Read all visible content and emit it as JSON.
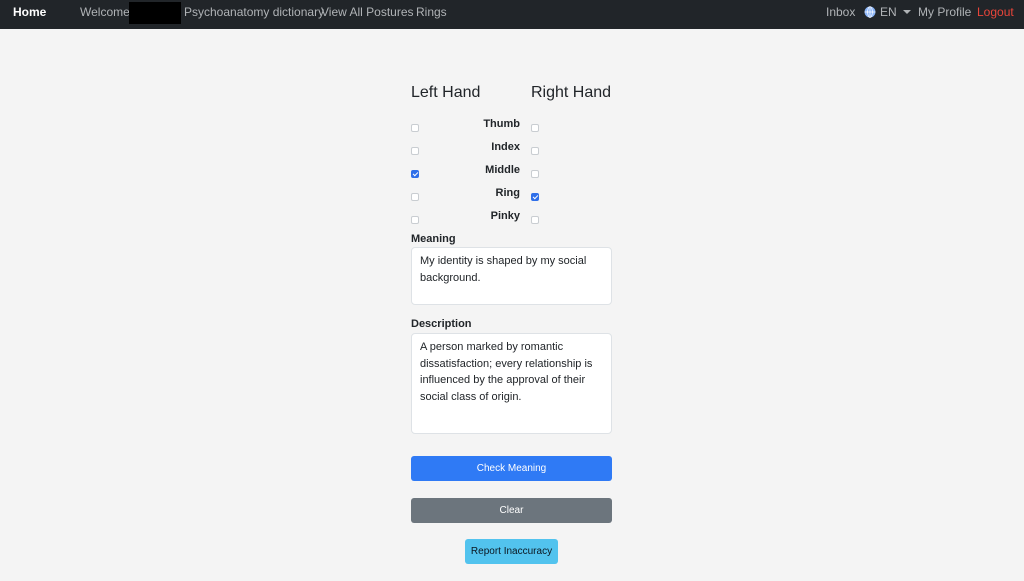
{
  "nav": {
    "brand": "Home",
    "welcome": "Welcome,",
    "links": [
      "Psychoanatomy dictionary",
      "View All Postures",
      "Rings"
    ],
    "inbox": "Inbox",
    "language": "EN",
    "profile": "My Profile",
    "logout": "Logout",
    "logout_color": "#e9453a"
  },
  "hands": {
    "left_title": "Left Hand",
    "right_title": "Right Hand",
    "fingers": [
      {
        "label": "Thumb",
        "left": false,
        "right": false
      },
      {
        "label": "Index",
        "left": false,
        "right": false
      },
      {
        "label": "Middle",
        "left": true,
        "right": false
      },
      {
        "label": "Ring",
        "left": false,
        "right": true
      },
      {
        "label": "Pinky",
        "left": false,
        "right": false
      }
    ]
  },
  "meaning": {
    "label": "Meaning",
    "value": "My identity is shaped by my social background."
  },
  "description": {
    "label": "Description",
    "value": "A person marked by romantic dissatisfaction; every relationship is influenced by the approval of their social class of origin."
  },
  "buttons": {
    "check": "Check Meaning",
    "clear": "Clear",
    "report": "Report Inaccuracy"
  },
  "colors": {
    "navbar": "#212529",
    "primary": "#2f7af5",
    "secondary": "#6c757d",
    "info": "#52c3ee",
    "checkbox_checked": "#2f6fe9"
  }
}
